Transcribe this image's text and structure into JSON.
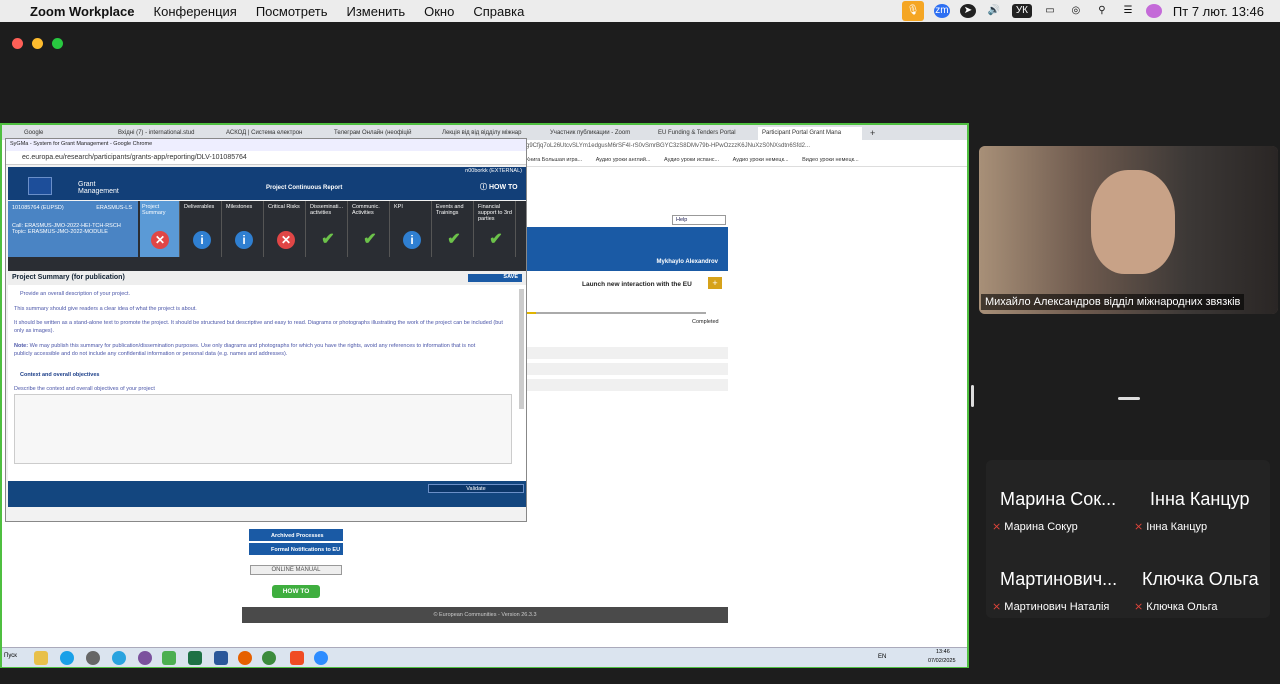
{
  "menubar": {
    "app": "Zoom Workplace",
    "items": [
      "Конференция",
      "Посмотреть",
      "Изменить",
      "Окно",
      "Справка"
    ],
    "lang": "УК",
    "datetime": "Пт 7 лют.  13:46"
  },
  "browser": {
    "tabs": [
      "Google",
      "Вхідні (7) - international.stud",
      "АСКОД | Система електрон",
      "Телеграм Онлайн (неофіцій",
      "Лекція від від відділу міжнар",
      "Участник публикации - Zoom",
      "EU Funding & Tenders Portal",
      "Participant Portal Grant Mana"
    ],
    "address": "g9Cfjq7oL26UtcvSLYm1edgusM6rSF4I-rS0vSmrBGYC3zS8DMv79b-HPwOzzzK6JNuXzS0NXsdtn6Sfd2...",
    "bookmarks": [
      "Книга Большая игра...",
      "Аудио уроки англий...",
      "Аудио уроки испанс...",
      "Аудио уроки немецк...",
      "Видео уроки немецк..."
    ]
  },
  "popup": {
    "title": "SyGMa - System for Grant Management - Google Chrome",
    "url": "ec.europa.eu/research/participants/grants-app/reporting/DLV-101085764",
    "user": "n00borkk (EXTERNAL)",
    "brand": "Grant Management",
    "report": "Project Continuous Report",
    "howto": "HOW TO",
    "project_id": "101085764 (EUPSD)",
    "programme": "ERASMUS-LS",
    "call": "Call: ERASMUS-JMO-2022-HEI-TCH-RSCH",
    "topic": "Topic: ERASMUS-JMO-2022-MODULE",
    "nav": [
      {
        "label": "Project Summary",
        "icon": "x"
      },
      {
        "label": "Deliverables",
        "icon": "i"
      },
      {
        "label": "Milestones",
        "icon": "i"
      },
      {
        "label": "Critical Risks",
        "icon": "x"
      },
      {
        "label": "Disseminati... activities",
        "icon": "check"
      },
      {
        "label": "Communic. Activities",
        "icon": "check"
      },
      {
        "label": "KPI",
        "icon": "i"
      },
      {
        "label": "Events and Trainings",
        "icon": "check"
      },
      {
        "label": "Financial support to 3rd parties",
        "icon": "check"
      }
    ],
    "section": "Project Summary (for publication)",
    "save": "SAVE",
    "p1": "Provide an overall description of your project.",
    "p2": "This summary should give readers a clear idea of what the project is about.",
    "p3": "It should be written as a stand-alone text to promote the project. It should be structured but descriptive and easy to read. Diagrams or photographs illustrating the work of the project can be included (but only as images).",
    "note_label": "Note:",
    "note": "We may publish this summary for publication/dissemination purposes. Use only diagrams and photographs for which you have the rights, avoid any references to information that is not publicly accessible and do not include any confidential information or personal data (e.g. names and addresses).",
    "sub": "Context and overall objectives",
    "sub_desc": "Describe the context and overall objectives of your project",
    "validate": "Validate"
  },
  "bgpage": {
    "help": "Help",
    "user": "Mykhaylo Alexandrov",
    "launch": "Launch new interaction with the EU",
    "completed": "Completed",
    "archived": "Archived Processes",
    "formal": "Formal Notifications to EU",
    "manual": "ONLINE MANUAL",
    "howto": "HOW TO",
    "footer": "© European Communities - Version 26.3.3"
  },
  "taskbar": {
    "start": "Пуск",
    "lang": "EN",
    "time": "13:46",
    "date": "07/02/2025"
  },
  "video": {
    "name": "Михайло Александров відділ міжнародних звязків"
  },
  "participants": [
    {
      "title": "Марина Сок...",
      "name": "Марина Сокур"
    },
    {
      "title": "Інна Канцур",
      "name": "Інна Канцур"
    },
    {
      "title": "Мартинович...",
      "name": "Мартинович Наталія"
    },
    {
      "title": "Ключка Ольга",
      "name": "Ключка Ольга"
    }
  ]
}
